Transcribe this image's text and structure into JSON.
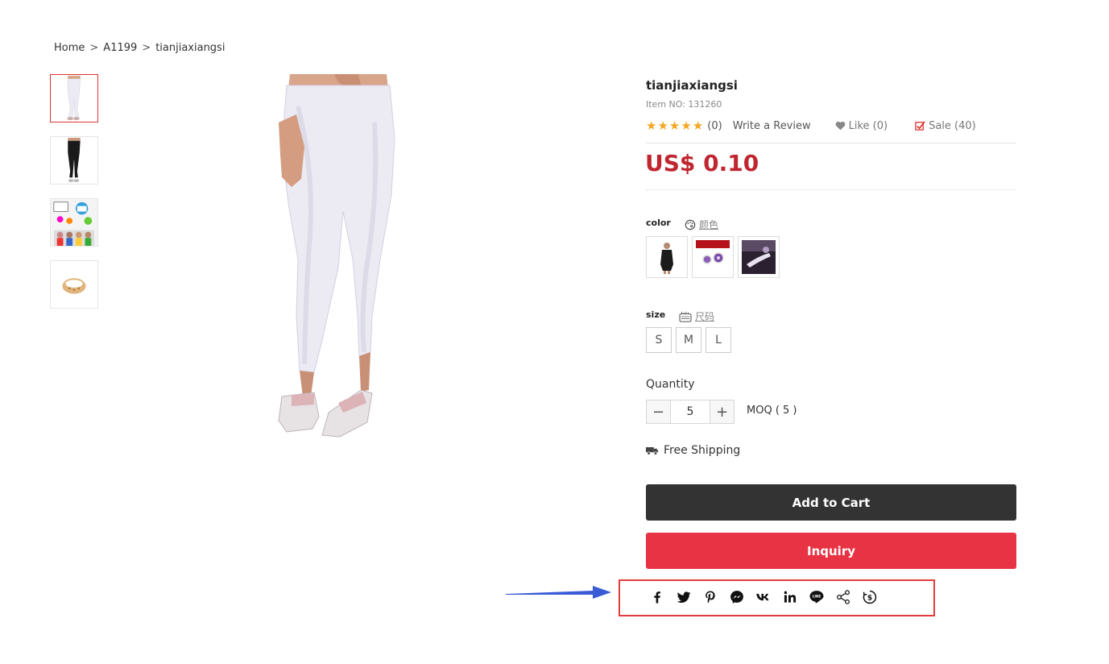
{
  "breadcrumb": {
    "home": "Home",
    "sep1": ">",
    "category": "A1199",
    "sep2": ">",
    "current": "tianjiaxiangsi"
  },
  "thumbnails": [
    {
      "name": "white-leggings-thumb",
      "selected": true
    },
    {
      "name": "black-leggings-thumb",
      "selected": false
    },
    {
      "name": "social-media-people-thumb",
      "selected": false
    },
    {
      "name": "gold-ring-thumb",
      "selected": false
    }
  ],
  "product": {
    "title": "tianjiaxiangsi",
    "item_no": "Item NO: 131260",
    "rating_stars": 5,
    "review_count": "(0)",
    "write_review": "Write a Review",
    "like": "Like (0)",
    "sale": "Sale (40)",
    "price": "US$ 0.10"
  },
  "color": {
    "label": "color",
    "hint": "颜色",
    "options": [
      "black-dress-swatch",
      "purple-earring-swatch",
      "dark-scene-swatch"
    ]
  },
  "size": {
    "label": "size",
    "hint": "尺码",
    "options": [
      "S",
      "M",
      "L"
    ]
  },
  "quantity": {
    "label": "Quantity",
    "minus": "−",
    "value": "5",
    "plus": "+",
    "moq": "MOQ ( 5 )"
  },
  "shipping": {
    "text": "Free Shipping"
  },
  "actions": {
    "add_to_cart": "Add to Cart",
    "inquiry": "Inquiry"
  },
  "share": {
    "icons": [
      "facebook-icon",
      "twitter-icon",
      "pinterest-icon",
      "messenger-icon",
      "vk-icon",
      "linkedin-icon",
      "line-icon",
      "share-icon",
      "commission-icon"
    ]
  },
  "colors": {
    "price": "#c0262f",
    "inquiry": "#e73343",
    "cart": "#333333",
    "star": "#f5a623",
    "annotation_box": "#e23b3b",
    "annotation_arrow": "#3a5bd6"
  }
}
